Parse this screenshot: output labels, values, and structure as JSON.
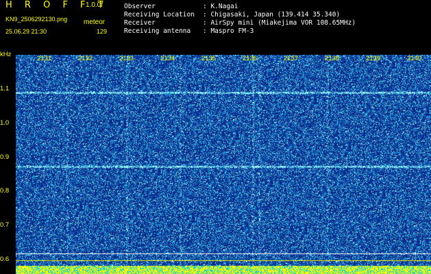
{
  "header": {
    "app_title": "H R O F F T",
    "version": "1.0.0f",
    "filename": "KN9_2506292130.png",
    "mode": "meteor",
    "datetime": "25.06.29 21:30",
    "count": "129"
  },
  "metadata": [
    {
      "label": "Observer",
      "value": ": K.Nagai"
    },
    {
      "label": "Receiving Location",
      "value": ": Chigasaki, Japan (139.414 35.340)"
    },
    {
      "label": "Receiver",
      "value": ": AirSpy mini (Miakejima VOR 108.65MHz)"
    },
    {
      "label": "Receiving antenna",
      "value": ": Maspro FM-3"
    }
  ],
  "spectrogram": {
    "y_unit": "kHz",
    "y_ticks": [
      "1.1",
      "1.0",
      "0.9",
      "0.8",
      "0.7",
      "0.6"
    ],
    "time_ticks": [
      "2131",
      "2132",
      "2133",
      "2134",
      "2135",
      "2136",
      "2137",
      "2138",
      "2139",
      "2140"
    ],
    "background_color": "#0a2a8a",
    "signal_color": "#40e0ff",
    "marker_color": "#ffff00"
  }
}
